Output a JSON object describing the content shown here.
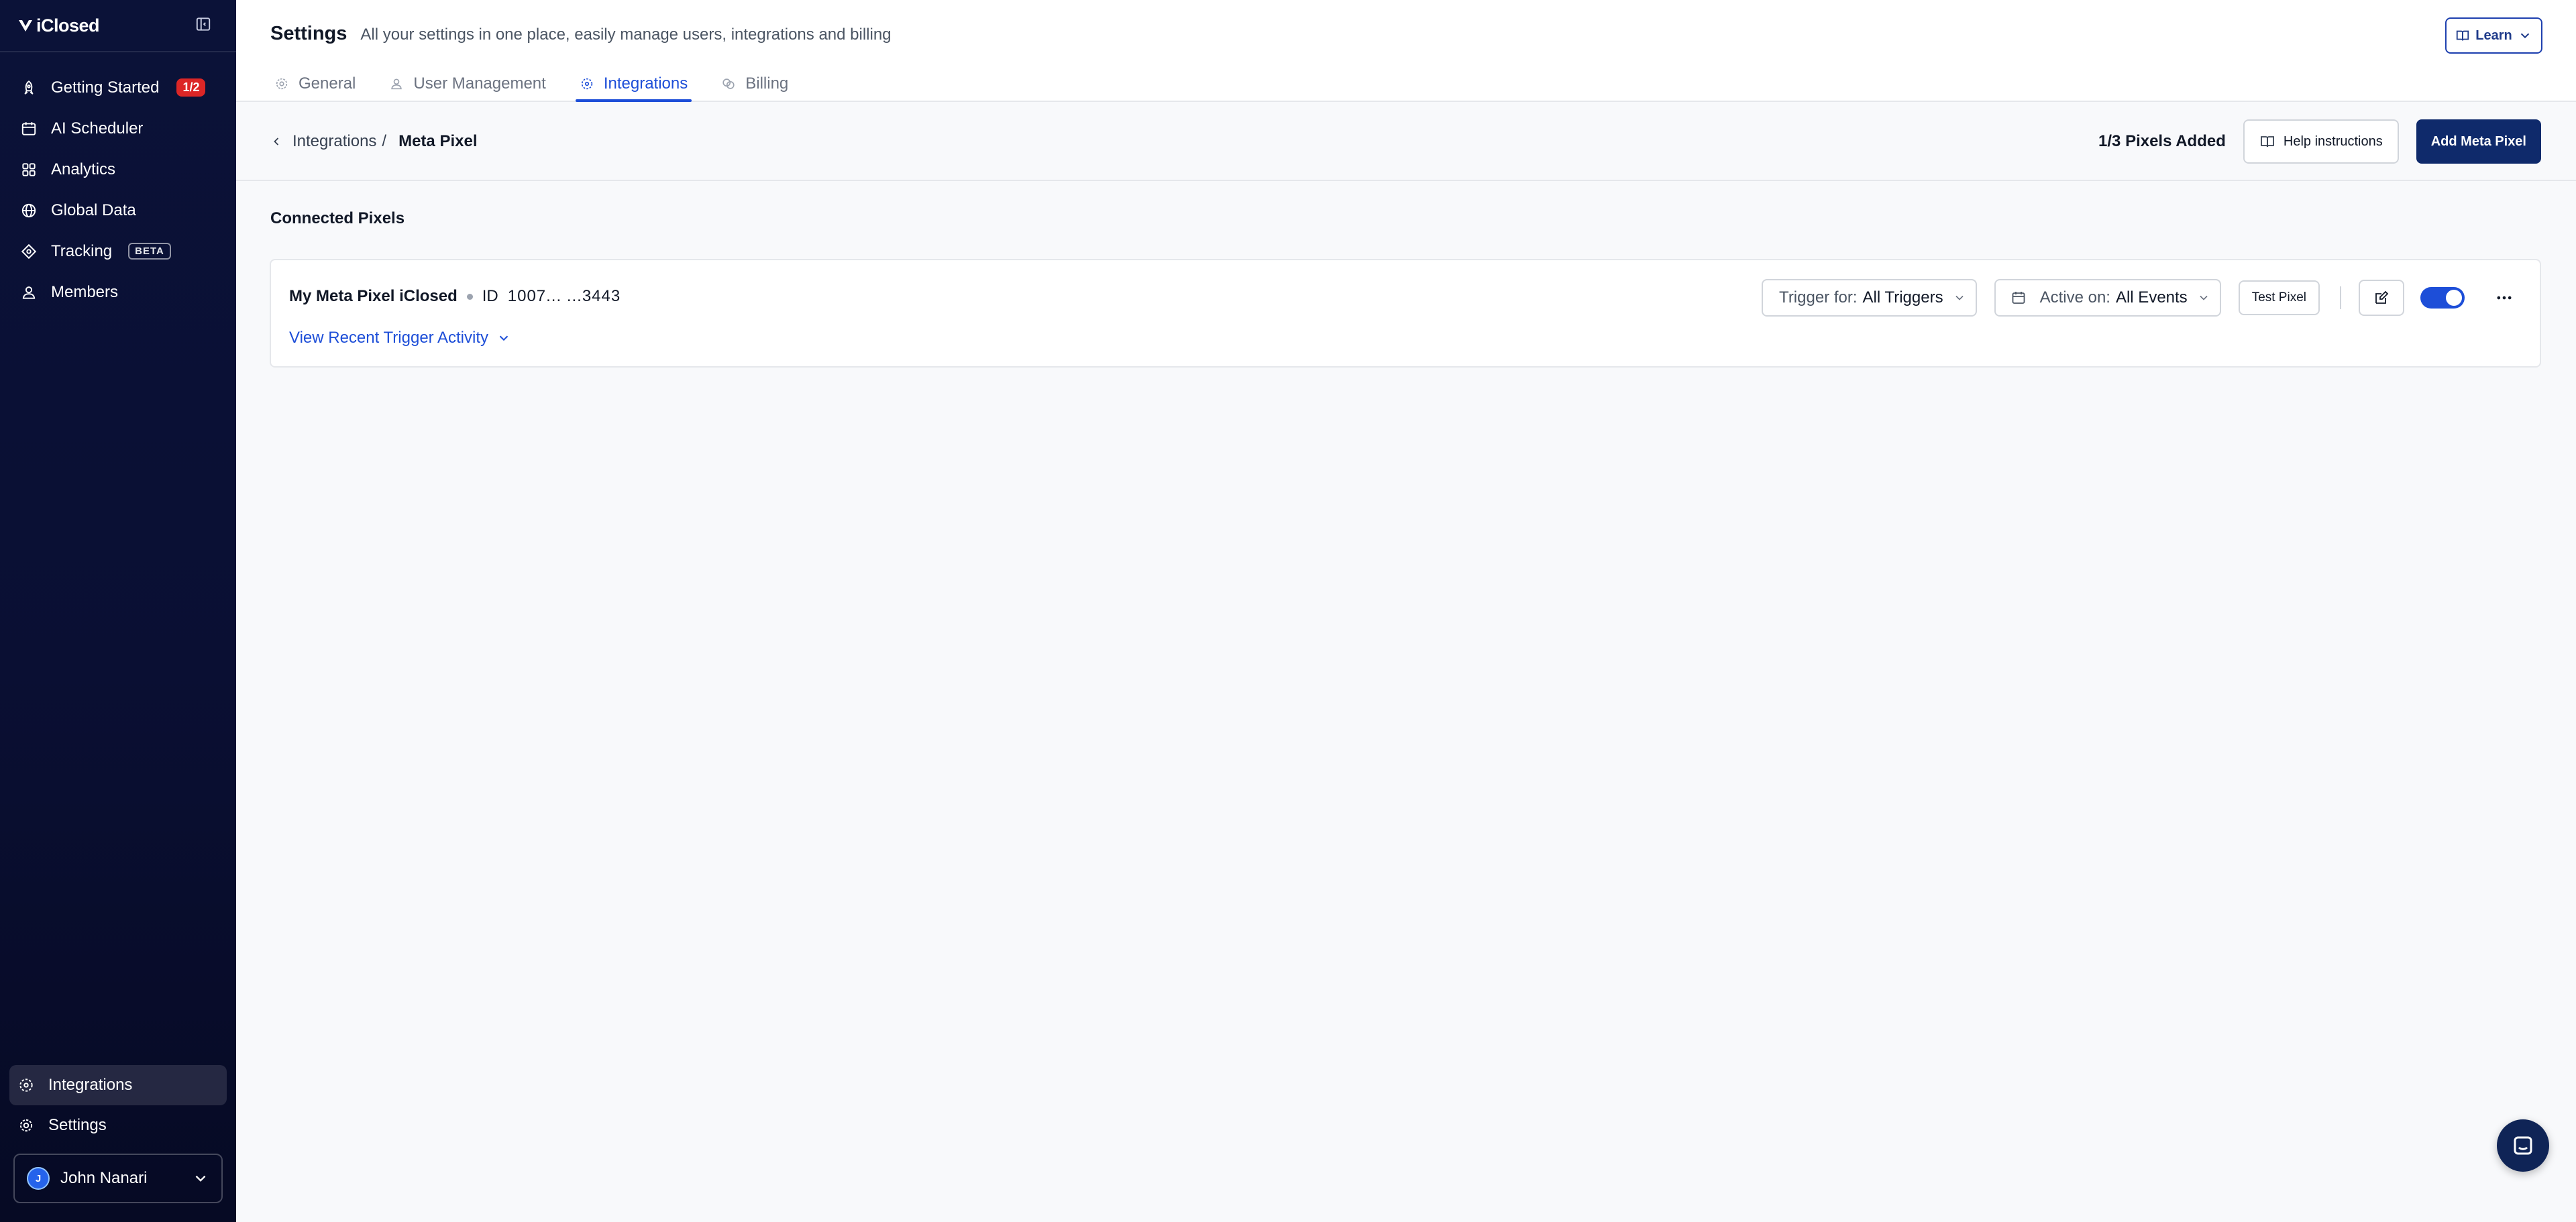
{
  "app": {
    "logo_text": "iClosed"
  },
  "sidebar": {
    "items": [
      {
        "label": "Getting Started",
        "badge": "1/2"
      },
      {
        "label": "AI Scheduler"
      },
      {
        "label": "Analytics"
      },
      {
        "label": "Global Data"
      },
      {
        "label": "Tracking",
        "badge": "BETA"
      },
      {
        "label": "Members"
      }
    ],
    "bottom_items": [
      {
        "label": "Integrations",
        "active": true
      },
      {
        "label": "Settings"
      }
    ],
    "user": {
      "name": "John Nanari",
      "initial": "J"
    }
  },
  "header": {
    "title": "Settings",
    "subtitle": "All your settings in one place, easily manage users, integrations and billing",
    "learn_label": "Learn",
    "tabs": [
      {
        "label": "General"
      },
      {
        "label": "User Management"
      },
      {
        "label": "Integrations",
        "active": true
      },
      {
        "label": "Billing"
      }
    ]
  },
  "subheader": {
    "breadcrumb_parent": "Integrations",
    "breadcrumb_separator": "/",
    "breadcrumb_current": "Meta Pixel",
    "pixel_count": "1/3 Pixels Added",
    "help_label": "Help instructions",
    "add_label": "Add Meta Pixel"
  },
  "content": {
    "section_title": "Connected Pixels",
    "pixel": {
      "name": "My Meta Pixel iClosed",
      "id_label": "ID",
      "id_value": "1007... ...3443",
      "activity_link": "View Recent Trigger Activity",
      "trigger_label": "Trigger for:",
      "trigger_value": "All Triggers",
      "active_label": "Active on:",
      "active_value": "All Events",
      "test_label": "Test Pixel",
      "enabled": true
    }
  },
  "colors": {
    "sidebar_bg": "#0b1238",
    "accent": "#1d4ed8",
    "primary_button": "#0f2a6b",
    "badge_red": "#dc2626"
  }
}
